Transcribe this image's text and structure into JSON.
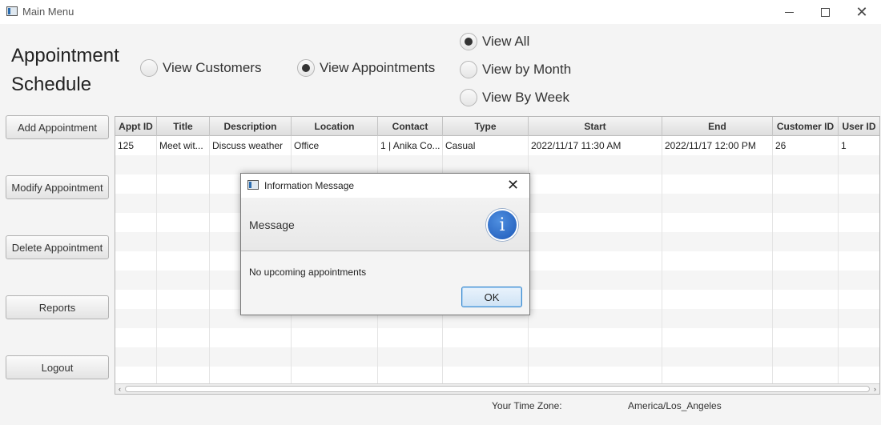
{
  "window": {
    "title": "Main Menu"
  },
  "heading": {
    "line1": "Appointment",
    "line2": "Schedule"
  },
  "view_toggle": {
    "customers_label": "View Customers",
    "appointments_label": "View Appointments",
    "selected": "appointments"
  },
  "filter": {
    "all_label": "View All",
    "month_label": "View by Month",
    "week_label": "View By Week",
    "selected": "all"
  },
  "sidebar": {
    "add_label": "Add Appointment",
    "modify_label": "Modify Appointment",
    "delete_label": "Delete Appointment",
    "reports_label": "Reports",
    "logout_label": "Logout"
  },
  "table": {
    "columns": [
      "Appt ID",
      "Title",
      "Description",
      "Location",
      "Contact",
      "Type",
      "Start",
      "End",
      "Customer ID",
      "User ID"
    ],
    "rows": [
      [
        "125",
        "Meet wit...",
        "Discuss weather",
        "Office",
        "1 | Anika Co...",
        "Casual",
        "2022/11/17 11:30 AM",
        "2022/11/17 12:00 PM",
        "26",
        "1"
      ]
    ]
  },
  "footer": {
    "tz_label": "Your Time Zone:",
    "tz_value": "America/Los_Angeles"
  },
  "dialog": {
    "title": "Information Message",
    "header": "Message",
    "icon_glyph": "i",
    "content": "No upcoming appointments",
    "ok_label": "OK"
  },
  "colors": {
    "accent": "#3a8ad0",
    "info_icon": "#1d59b8"
  }
}
